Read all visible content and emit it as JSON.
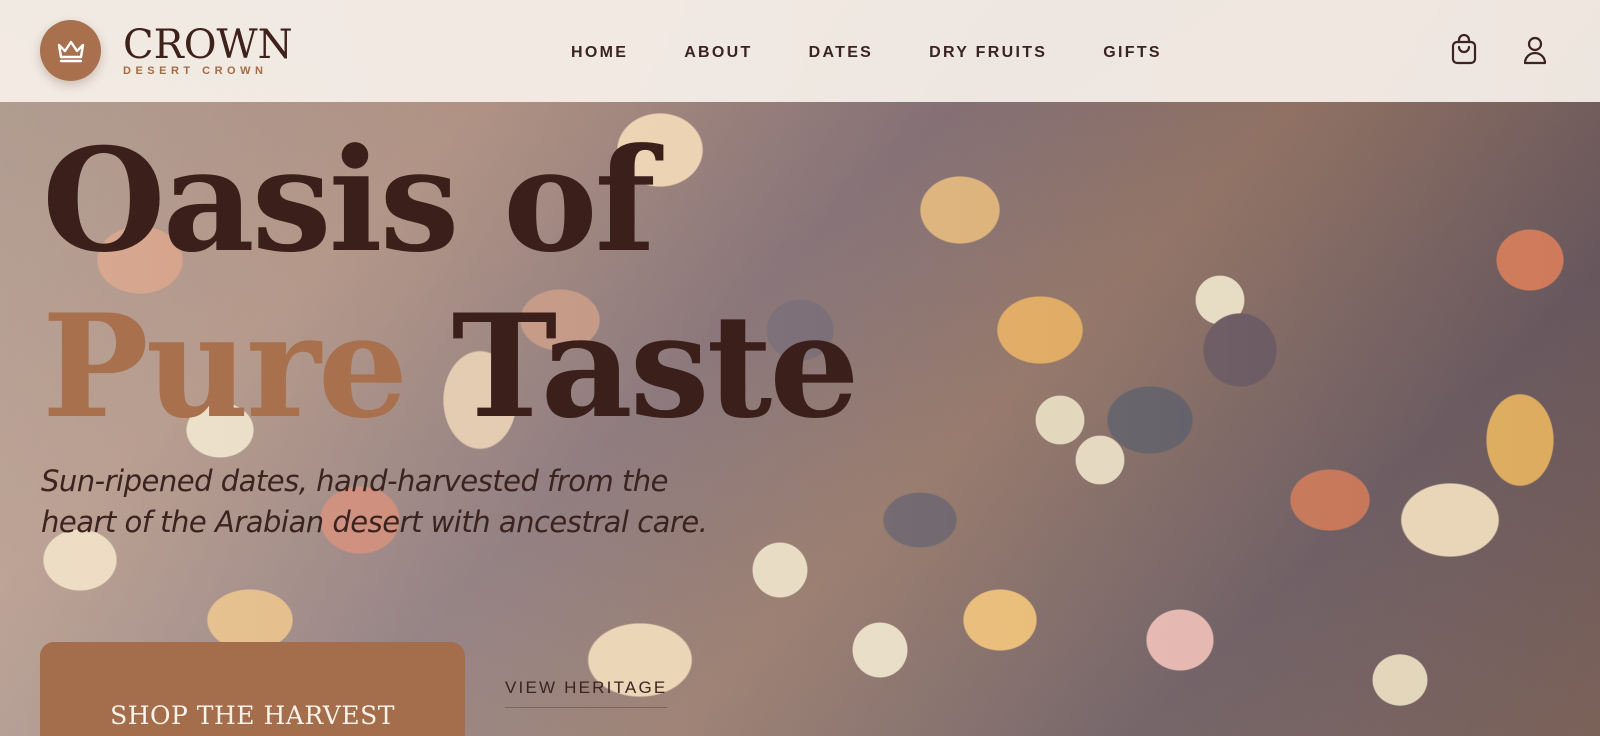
{
  "brand": {
    "name": "CROWN",
    "tagline": "DESERT CROWN",
    "badge_icon": "crown-icon",
    "badge_color": "#a8704d"
  },
  "nav": {
    "items": [
      "HOME",
      "ABOUT",
      "DATES",
      "DRY FRUITS",
      "GIFTS"
    ]
  },
  "header_icons": {
    "cart": "shopping-bag-icon",
    "account": "user-icon"
  },
  "hero": {
    "headline_line1": "Oasis of",
    "headline_accent": "Pure",
    "headline_rest": " Taste",
    "subtitle": "Sun-ripened dates, hand-harvested from the heart of the Arabian desert with ancestral care.",
    "primary_cta": "SHOP THE HARVEST",
    "secondary_cta": "VIEW HERITAGE",
    "background": "dried-fruit-and-nut-mix-photo"
  },
  "colors": {
    "accent": "#a8704d",
    "text_dark": "#3b1f1b",
    "header_bg": "#f6f0e9"
  }
}
